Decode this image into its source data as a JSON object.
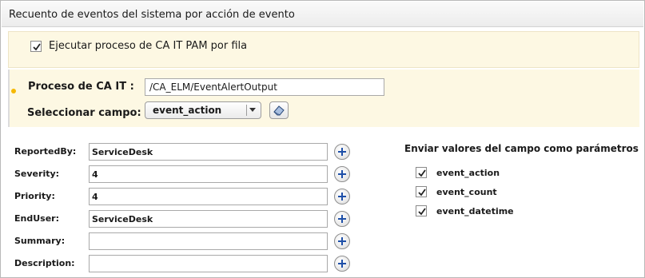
{
  "window": {
    "title": "Recuento de eventos del sistema por acción de evento"
  },
  "run_option": {
    "label": "Ejecutar proceso de CA IT PAM por fila",
    "checked": true
  },
  "process": {
    "label": "Proceso de CA IT :",
    "value": "/CA_ELM/EventAlertOutput"
  },
  "field_select": {
    "label": "Seleccionar campo:",
    "value": "event_action"
  },
  "params": [
    {
      "label": "ReportedBy:",
      "value": "ServiceDesk"
    },
    {
      "label": "Severity:",
      "value": "4"
    },
    {
      "label": "Priority:",
      "value": "4"
    },
    {
      "label": "EndUser:",
      "value": "ServiceDesk"
    },
    {
      "label": "Summary:",
      "value": ""
    },
    {
      "label": "Description:",
      "value": ""
    }
  ],
  "send_values": {
    "title": "Enviar valores del campo como parámetros",
    "items": [
      {
        "label": "event_action",
        "checked": true
      },
      {
        "label": "event_count",
        "checked": true
      },
      {
        "label": "event_datetime",
        "checked": true
      }
    ]
  },
  "icons": {
    "plus": "plus-circle-icon",
    "picker": "eraser-icon",
    "dropdown": "chevron-down-icon",
    "check": "checkmark-icon"
  },
  "colors": {
    "panel_bg": "#fdf8e3",
    "accent_bullet": "#f5b800",
    "plus_blue": "#1e4fa8"
  }
}
